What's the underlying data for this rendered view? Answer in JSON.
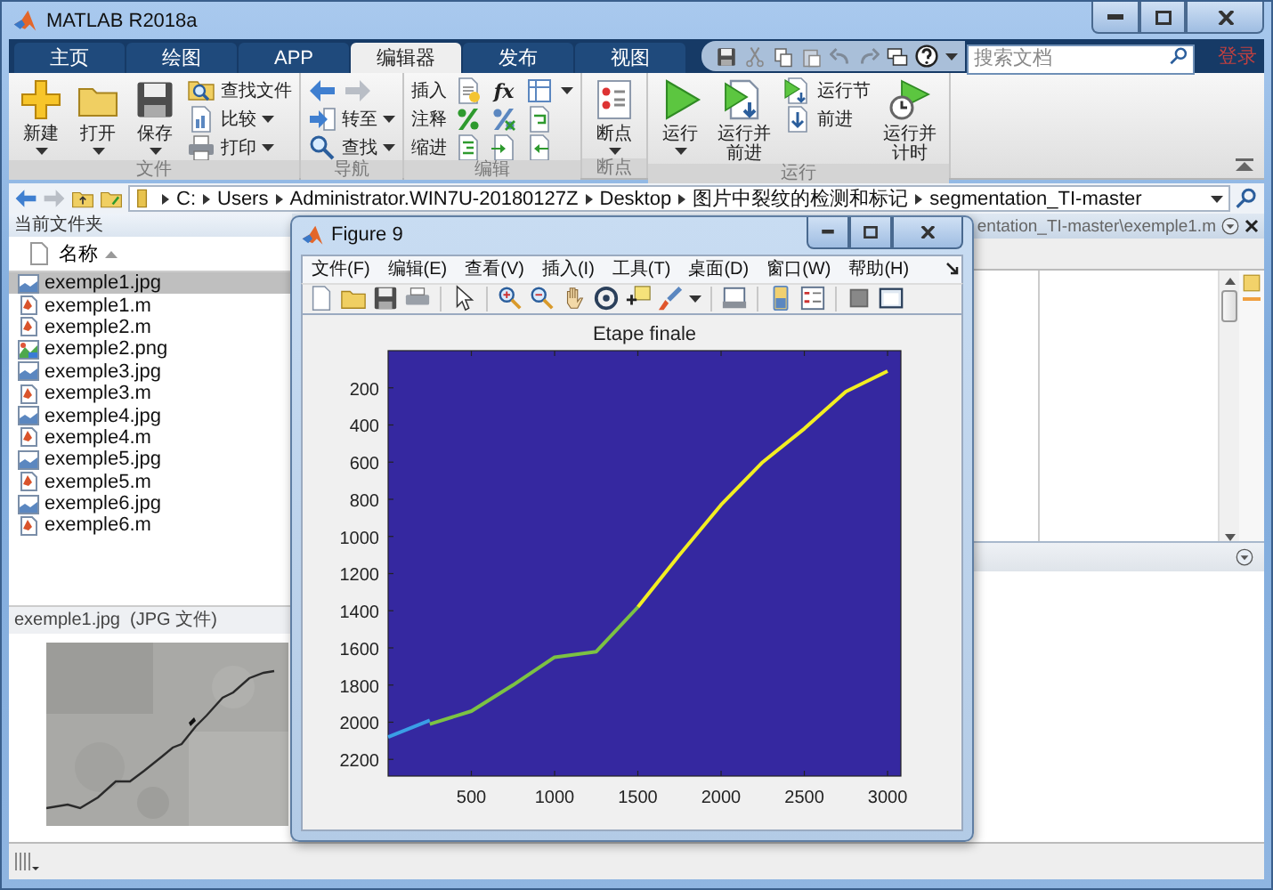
{
  "window": {
    "title": "MATLAB R2018a"
  },
  "tabs": [
    {
      "label": "主页",
      "selected": false
    },
    {
      "label": "绘图",
      "selected": false
    },
    {
      "label": "APP",
      "selected": false
    },
    {
      "label": "编辑器",
      "selected": true
    },
    {
      "label": "发布",
      "selected": false
    },
    {
      "label": "视图",
      "selected": false
    }
  ],
  "search": {
    "placeholder": "搜索文档"
  },
  "login_button": "登录",
  "ribbon": [
    {
      "label": "文件",
      "columns": [
        {
          "kind": "big",
          "label": "新建",
          "dropdown": true
        },
        {
          "kind": "big",
          "label": "打开",
          "dropdown": true
        },
        {
          "kind": "big",
          "label": "保存",
          "dropdown": true
        },
        {
          "kind": "stack",
          "items": [
            {
              "kind": "button",
              "label": "查找文件",
              "dropdown": false
            },
            {
              "kind": "button",
              "label": "比较",
              "dropdown": true
            },
            {
              "kind": "button",
              "label": "打印",
              "dropdown": true
            }
          ]
        }
      ]
    },
    {
      "label": "导航",
      "columns": [
        {
          "kind": "stack",
          "items": [
            {
              "kind": "arrows"
            },
            {
              "kind": "button",
              "label": "转至",
              "dropdown": true
            },
            {
              "kind": "button",
              "label": "查找",
              "dropdown": true
            }
          ]
        }
      ]
    },
    {
      "label": "编辑",
      "columns": [
        {
          "kind": "rows",
          "items": [
            {
              "label": "插入",
              "function_button": "fx",
              "dropdown": true
            },
            {
              "label": "注释",
              "dropdown": false
            },
            {
              "label": "缩进",
              "dropdown": false
            }
          ]
        }
      ]
    },
    {
      "label": "断点",
      "columns": [
        {
          "kind": "big",
          "label": "断点",
          "dropdown": true
        }
      ]
    },
    {
      "label": "运行",
      "columns": [
        {
          "kind": "big",
          "label": "运行",
          "dropdown": true
        },
        {
          "kind": "big",
          "label": "运行并前进",
          "dropdown": false
        },
        {
          "kind": "stack",
          "items": [
            {
              "kind": "button",
              "label": "运行节",
              "dropdown": false
            },
            {
              "kind": "button",
              "label": "前进",
              "dropdown": false
            }
          ]
        },
        {
          "kind": "big",
          "label": "运行并计时",
          "dropdown": false
        }
      ]
    }
  ],
  "address_bar": {
    "path": [
      "C:",
      "Users",
      "Administrator.WIN7U-20180127Z",
      "Desktop",
      "图片中裂纹的检测和标记",
      "segmentation_TI-master"
    ]
  },
  "current_folder": {
    "title": "当前文件夹",
    "column": "名称",
    "files": [
      {
        "name": "exemple1.jpg",
        "kind": "jpg",
        "selected": true
      },
      {
        "name": "exemple1.m",
        "kind": "m",
        "selected": false
      },
      {
        "name": "exemple2.m",
        "kind": "m",
        "selected": false
      },
      {
        "name": "exemple2.png",
        "kind": "png",
        "selected": false
      },
      {
        "name": "exemple3.jpg",
        "kind": "jpg",
        "selected": false
      },
      {
        "name": "exemple3.m",
        "kind": "m",
        "selected": false
      },
      {
        "name": "exemple4.jpg",
        "kind": "jpg",
        "selected": false
      },
      {
        "name": "exemple4.m",
        "kind": "m",
        "selected": false
      },
      {
        "name": "exemple5.jpg",
        "kind": "jpg",
        "selected": false
      },
      {
        "name": "exemple5.m",
        "kind": "m",
        "selected": false
      },
      {
        "name": "exemple6.jpg",
        "kind": "jpg",
        "selected": false
      },
      {
        "name": "exemple6.m",
        "kind": "m",
        "selected": false
      }
    ]
  },
  "details": {
    "file": "exemple1.jpg",
    "type": "(JPG 文件)"
  },
  "editor": {
    "title": "entation_TI-master\\exemple1.m"
  },
  "figure": {
    "title": "Figure 9",
    "menu": [
      "文件(F)",
      "编辑(E)",
      "查看(V)",
      "插入(I)",
      "工具(T)",
      "桌面(D)",
      "窗口(W)",
      "帮助(H)"
    ],
    "chart_data": {
      "type": "line",
      "title": "Etape finale",
      "x": [
        0,
        250,
        500,
        750,
        1000,
        1250,
        1500,
        1750,
        2000,
        2250,
        2500,
        2750,
        3000
      ],
      "series": [
        {
          "color": "#3a9ee6",
          "values": [
            2080,
            1990,
            null,
            null,
            null,
            null,
            null,
            null,
            null,
            null,
            null,
            null,
            null
          ]
        },
        {
          "color": "#7cc243",
          "values": [
            null,
            2010,
            1940,
            1800,
            1650,
            1620,
            1380,
            null,
            null,
            null,
            null,
            null,
            null
          ]
        },
        {
          "color": "#f2ee22",
          "values": [
            null,
            null,
            null,
            null,
            null,
            null,
            1380,
            1100,
            830,
            600,
            420,
            220,
            110
          ]
        }
      ],
      "xlim": [
        0,
        3080
      ],
      "ylim": [
        2290,
        0
      ],
      "xticks": [
        500,
        1000,
        1500,
        2000,
        2500,
        3000
      ],
      "yticks": [
        200,
        400,
        600,
        800,
        1000,
        1200,
        1400,
        1600,
        1800,
        2000,
        2200
      ]
    }
  }
}
